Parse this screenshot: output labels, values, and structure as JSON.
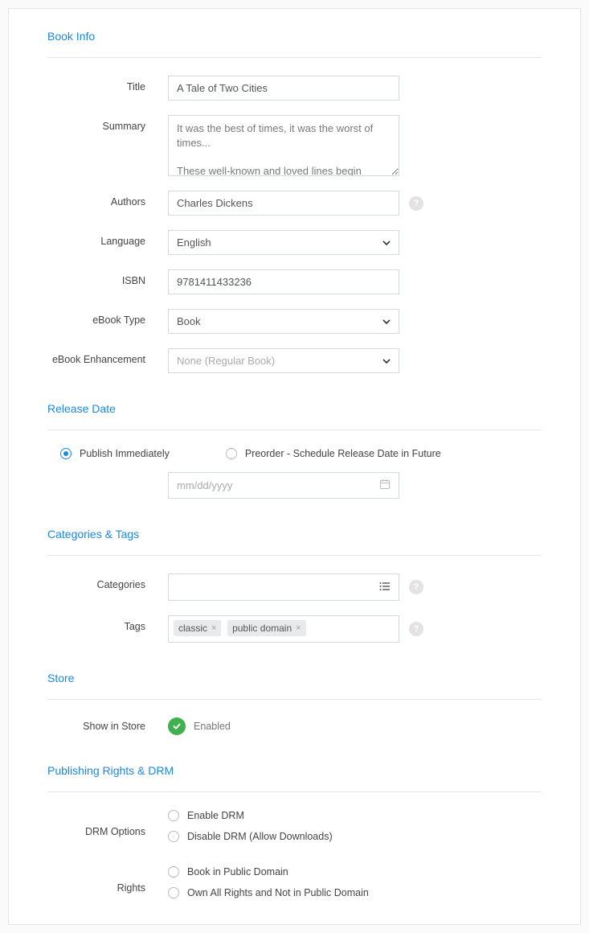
{
  "sections": {
    "book_info": "Book Info",
    "release_date": "Release Date",
    "categories_tags": "Categories & Tags",
    "store": "Store",
    "rights": "Publishing Rights & DRM"
  },
  "labels": {
    "title": "Title",
    "summary": "Summary",
    "authors": "Authors",
    "language": "Language",
    "isbn": "ISBN",
    "ebook_type": "eBook Type",
    "ebook_enhancement": "eBook Enhancement",
    "categories": "Categories",
    "tags": "Tags",
    "show_in_store": "Show in Store",
    "drm_options": "DRM Options",
    "rights": "Rights"
  },
  "values": {
    "title": "A Tale of Two Cities",
    "summary": "It was the best of times, it was the worst of times...\n\nThese well-known and loved lines begin Dickens's most exciting novel, set during the bloodiest moments of the French Revolution. When former aristocrat Charles Darnay learns that an old family",
    "authors": "Charles Dickens",
    "language": "English",
    "isbn": "9781411433236",
    "ebook_type": "Book",
    "ebook_enhancement": "None (Regular Book)",
    "date_placeholder": "mm/dd/yyyy"
  },
  "release": {
    "publish_immediately": "Publish Immediately",
    "preorder": "Preorder - Schedule Release Date in Future"
  },
  "tags": [
    "classic",
    "public domain"
  ],
  "store": {
    "enabled": "Enabled"
  },
  "drm": {
    "enable": "Enable DRM",
    "disable": "Disable DRM (Allow Downloads)"
  },
  "rights_options": {
    "public_domain": "Book in Public Domain",
    "own_all": "Own All Rights and Not in Public Domain"
  },
  "help_icon": "?"
}
